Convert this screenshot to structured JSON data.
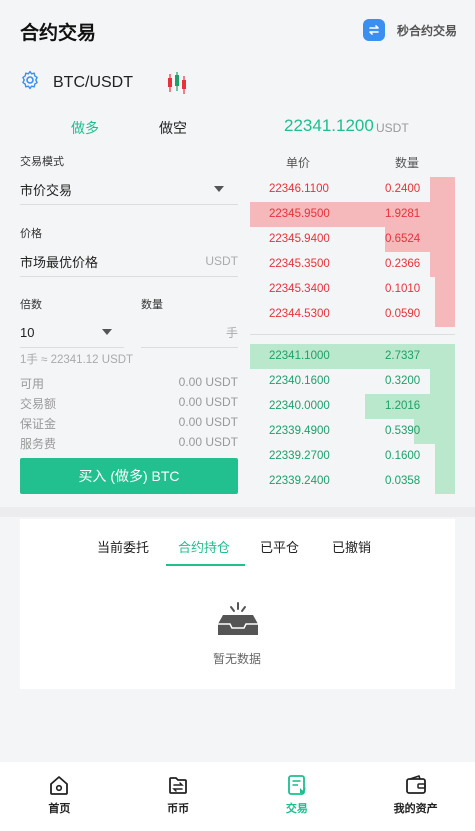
{
  "header": {
    "title": "合约交易",
    "second_contract_label": "秒合约交易"
  },
  "pair": {
    "name": "BTC/USDT"
  },
  "trade_tabs": {
    "long": "做多",
    "short": "做空"
  },
  "last_price": {
    "value": "22341.1200",
    "unit": "USDT"
  },
  "form": {
    "mode_label": "交易模式",
    "mode_value": "市价交易",
    "price_label": "价格",
    "price_value": "市场最优价格",
    "price_unit": "USDT",
    "leverage_label": "倍数",
    "leverage_value": "10",
    "qty_label": "数量",
    "qty_unit": "手",
    "conversion": "1手 ≈ 22341.12 USDT",
    "info": [
      {
        "label": "可用",
        "value": "0.00 USDT"
      },
      {
        "label": "交易额",
        "value": "0.00 USDT"
      },
      {
        "label": "保证金",
        "value": "0.00 USDT"
      },
      {
        "label": "服务费",
        "value": "0.00 USDT"
      }
    ],
    "buy_button": "买入 (做多) BTC"
  },
  "orderbook": {
    "price_header": "单价",
    "qty_header": "数量",
    "asks": [
      {
        "price": "22346.1100",
        "qty": "0.2400",
        "depth": 0.12
      },
      {
        "price": "22345.9500",
        "qty": "1.9281",
        "depth": 1.0
      },
      {
        "price": "22345.9400",
        "qty": "0.6524",
        "depth": 0.34
      },
      {
        "price": "22345.3500",
        "qty": "0.2366",
        "depth": 0.12
      },
      {
        "price": "22345.3400",
        "qty": "0.1010",
        "depth": 0.1
      },
      {
        "price": "22344.5300",
        "qty": "0.0590",
        "depth": 0.1
      }
    ],
    "bids": [
      {
        "price": "22341.1000",
        "qty": "2.7337",
        "depth": 1.0
      },
      {
        "price": "22340.1600",
        "qty": "0.3200",
        "depth": 0.12
      },
      {
        "price": "22340.0000",
        "qty": "1.2016",
        "depth": 0.44
      },
      {
        "price": "22339.4900",
        "qty": "0.5390",
        "depth": 0.2
      },
      {
        "price": "22339.2700",
        "qty": "0.1600",
        "depth": 0.1
      },
      {
        "price": "22339.2400",
        "qty": "0.0358",
        "depth": 0.1
      }
    ],
    "ask_color": "#e8323a",
    "bid_color": "#1ea06a"
  },
  "positions": {
    "tabs": [
      "当前委托",
      "合约持仓",
      "已平仓",
      "已撤销"
    ],
    "active_tab": 1,
    "empty_text": "暂无数据"
  },
  "nav": {
    "items": [
      {
        "label": "首页",
        "icon": "home-icon"
      },
      {
        "label": "币币",
        "icon": "coin-exchange-icon"
      },
      {
        "label": "交易",
        "icon": "trade-icon"
      },
      {
        "label": "我的资产",
        "icon": "wallet-icon"
      }
    ],
    "active": 2
  },
  "colors": {
    "accent": "#22c08f",
    "ask": "#e8323a",
    "bid": "#1ea06a"
  }
}
